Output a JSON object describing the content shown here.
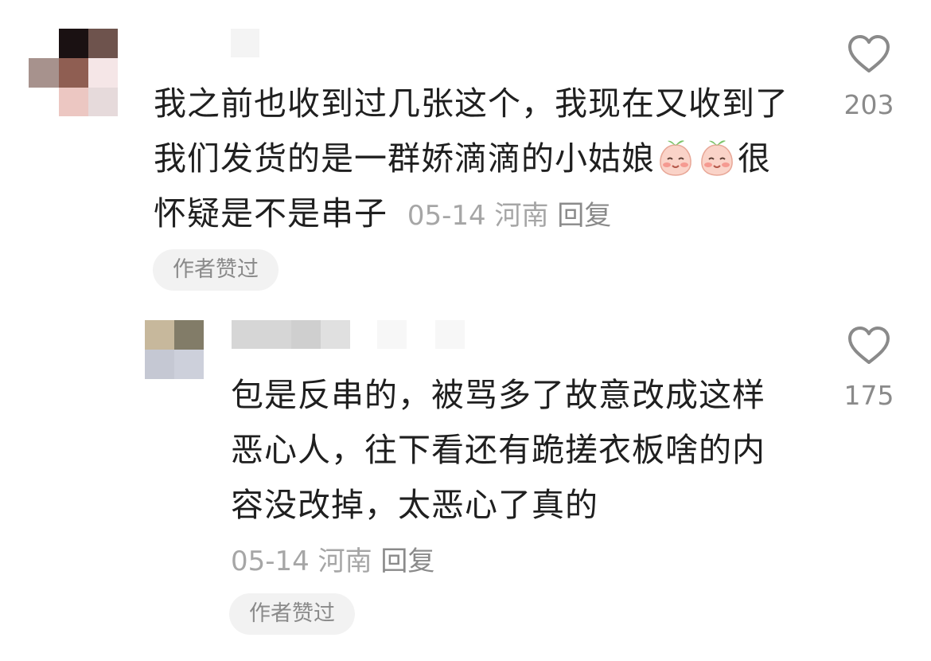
{
  "comments": [
    {
      "text_lines": [
        "我之前也收到过几张这个，我现在又收到了",
        "我们发货的是一群娇滴滴的小姑娘",
        "很",
        "怀疑是不是串子"
      ],
      "emoji": "face-with-smile-emoji",
      "date": "05-14",
      "location": "河南",
      "reply_label": "回复",
      "author_liked_label": "作者赞过",
      "like_count": "203"
    },
    {
      "text_lines": [
        "包是反串的，被骂多了故意改成这样",
        "恶心人，往下看还有跪搓衣板啥的内",
        "容没改掉，太恶心了真的"
      ],
      "date": "05-14",
      "location": "河南",
      "reply_label": "回复",
      "author_liked_label": "作者赞过",
      "like_count": "175"
    }
  ],
  "colors": {
    "text": "#1f1f1f",
    "meta": "#a6a6a6",
    "badge_bg": "#f2f2f2",
    "icon": "#8a8a8a"
  }
}
